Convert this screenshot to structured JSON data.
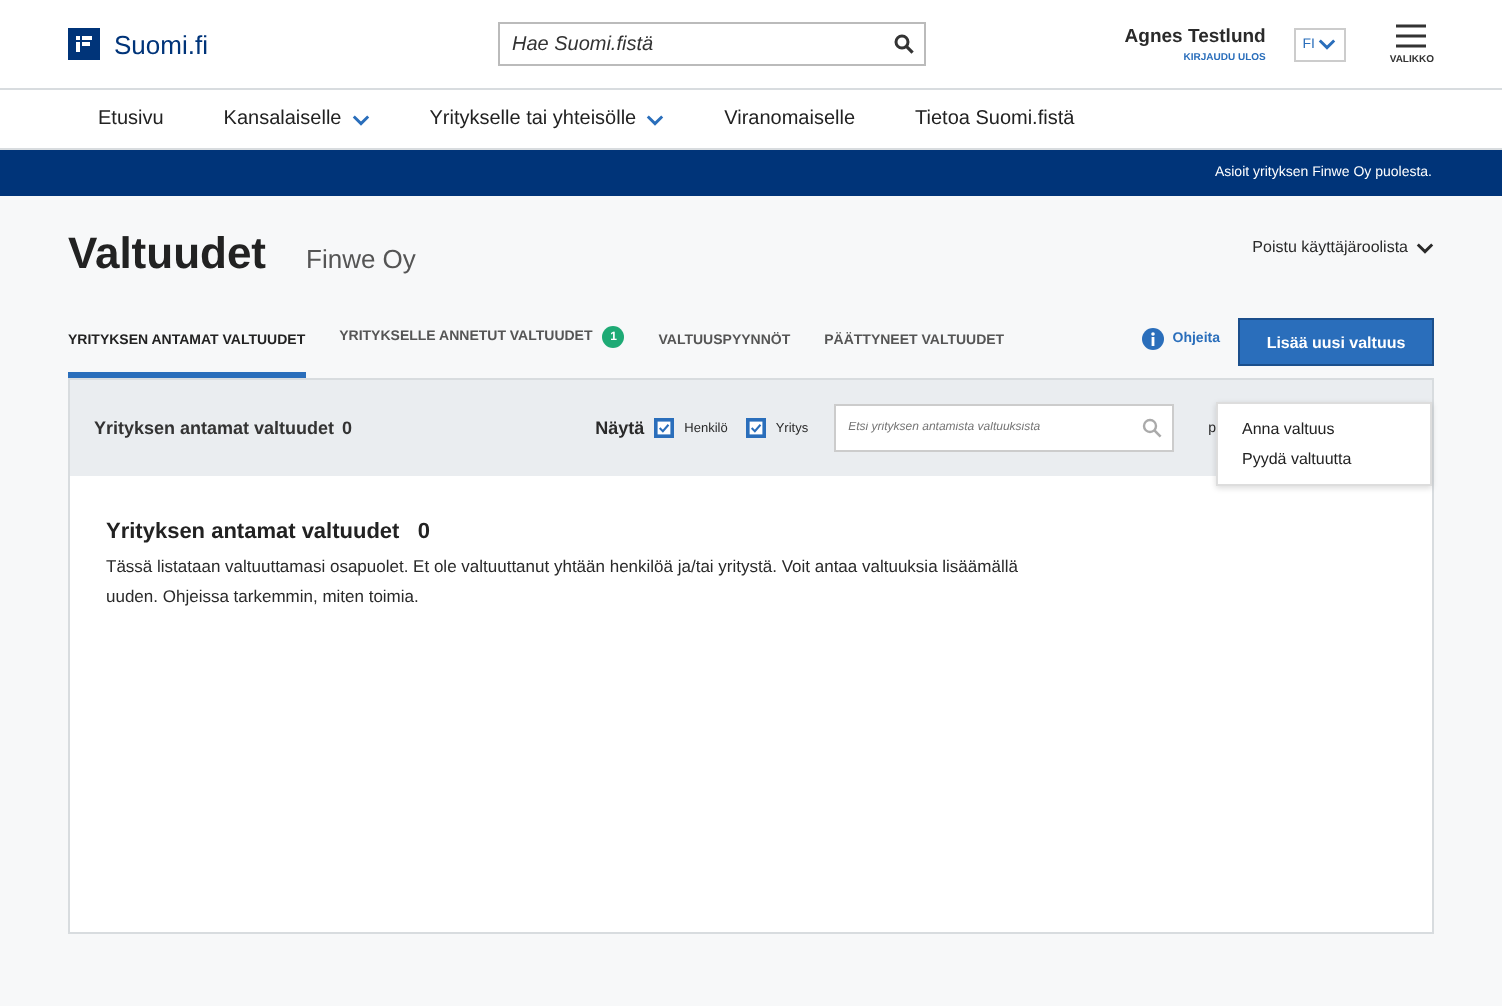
{
  "header": {
    "logo": "Suomi.fi",
    "search": {
      "placeholder": "Hae Suomi.fistä"
    },
    "user": {
      "name": "Agnes Testlund",
      "logout": "KIRJAUDU ULOS"
    },
    "language": "FI",
    "menu_label": "VALIKKO"
  },
  "nav": [
    {
      "label": "Etusivu",
      "dropdown": false
    },
    {
      "label": "Kansalaiselle",
      "dropdown": true
    },
    {
      "label": "Yritykselle tai yhteisölle",
      "dropdown": true
    },
    {
      "label": "Viranomaiselle",
      "dropdown": false
    },
    {
      "label": "Tietoa Suomi.fistä",
      "dropdown": false
    }
  ],
  "banner": "Asioit yrityksen Finwe Oy puolesta.",
  "page": {
    "title": "Valtuudet",
    "subtitle": "Finwe Oy",
    "role_menu": "Poistu käyttäjäroolista"
  },
  "tabs": [
    {
      "label": "YRITYKSEN ANTAMAT VALTUUDET",
      "selected": true
    },
    {
      "label": "YRITYKSELLE ANNETUT VALTUUDET",
      "selected": false,
      "badge": "1"
    },
    {
      "label": "VALTUUSPYYNNÖT",
      "selected": false
    },
    {
      "label": "PÄÄTTYNEET VALTUUDET",
      "selected": false
    }
  ],
  "help_link": "Ohjeita",
  "add_button": "Lisää uusi valtuus",
  "add_menu": [
    {
      "label": "Anna valtuus"
    },
    {
      "label": "Pyydä valtuutta"
    }
  ],
  "toolbar": {
    "title": "Yrityksen antamat valtuudet",
    "count": "0",
    "show_label": "Näytä",
    "filters": [
      {
        "label": "Henkilö",
        "checked": true
      },
      {
        "label": "Yritys",
        "checked": true
      }
    ],
    "search": {
      "placeholder": "Etsi yrityksen antamista valtuuksista"
    },
    "cut_text": "p"
  },
  "content": {
    "title": "Yrityksen antamat valtuudet",
    "count": "0",
    "text": "Tässä listataan valtuuttamasi osapuolet. Et ole valtuuttanut yhtään henkilöä ja/tai yritystä. Voit antaa valtuuksia lisäämällä uuden. Ohjeissa tarkemmin, miten toimia."
  }
}
